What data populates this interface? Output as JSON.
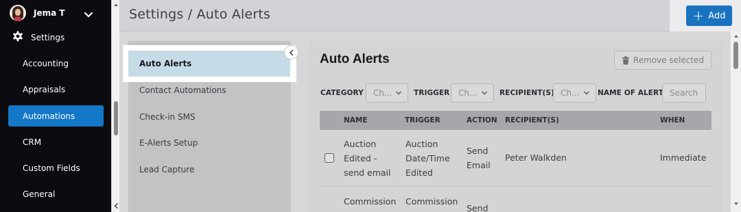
{
  "user": {
    "name": "Jema T"
  },
  "sidebar": {
    "section_label": "Settings",
    "items": [
      {
        "label": "Accounting",
        "active": false
      },
      {
        "label": "Appraisals",
        "active": false
      },
      {
        "label": "Automations",
        "active": true
      },
      {
        "label": "CRM",
        "active": false
      },
      {
        "label": "Custom Fields",
        "active": false
      },
      {
        "label": "General",
        "active": false
      }
    ]
  },
  "header": {
    "title": "Settings / Auto Alerts",
    "add_label": "Add"
  },
  "subnav": {
    "items": [
      {
        "label": "Auto Alerts",
        "active": true
      },
      {
        "label": "Contact Automations",
        "active": false
      },
      {
        "label": "Check-in SMS",
        "active": false
      },
      {
        "label": "E-Alerts Setup",
        "active": false
      },
      {
        "label": "Lead Capture",
        "active": false
      }
    ]
  },
  "main": {
    "title": "Auto Alerts",
    "remove_selected_label": "Remove selected",
    "filters": {
      "category_label": "CATEGORY",
      "category_value": "Ch...",
      "trigger_label": "TRIGGER",
      "trigger_value": "Ch...",
      "recipients_label": "RECIPIENT(S)",
      "recipients_value": "Ch...",
      "name_label": "NAME OF ALERT",
      "search_placeholder": "Search"
    },
    "table": {
      "headers": {
        "name": "NAME",
        "trigger": "TRIGGER",
        "action": "ACTION",
        "recipients": "RECIPIENT(S)",
        "when": "WHEN"
      },
      "rows": [
        {
          "name_lines": [
            "Auction",
            "Edited -",
            "send email"
          ],
          "trigger_lines": [
            "Auction",
            "Date/Time",
            "Edited"
          ],
          "action_lines": [
            "Send",
            "Email"
          ],
          "recipients": "Peter Walkden",
          "when": "Immediate"
        },
        {
          "name_lines": [
            "Commission"
          ],
          "trigger_lines": [
            "Commission"
          ],
          "action_lines": [
            "Send"
          ],
          "recipients": "",
          "when": ""
        }
      ]
    }
  },
  "colors": {
    "sidebar_bg": "#0b0b10",
    "active_blue": "#1478c8",
    "add_button": "#1a73c0",
    "subnav_active": "#c5dbe6"
  },
  "icons": {
    "user_avatar": "avatar",
    "user_menu": "chevron-down-icon",
    "settings": "gear-icon",
    "add": "plus-icon",
    "remove": "trash-icon",
    "collapse": "chevron-left-icon",
    "select": "chevron-down-icon"
  }
}
